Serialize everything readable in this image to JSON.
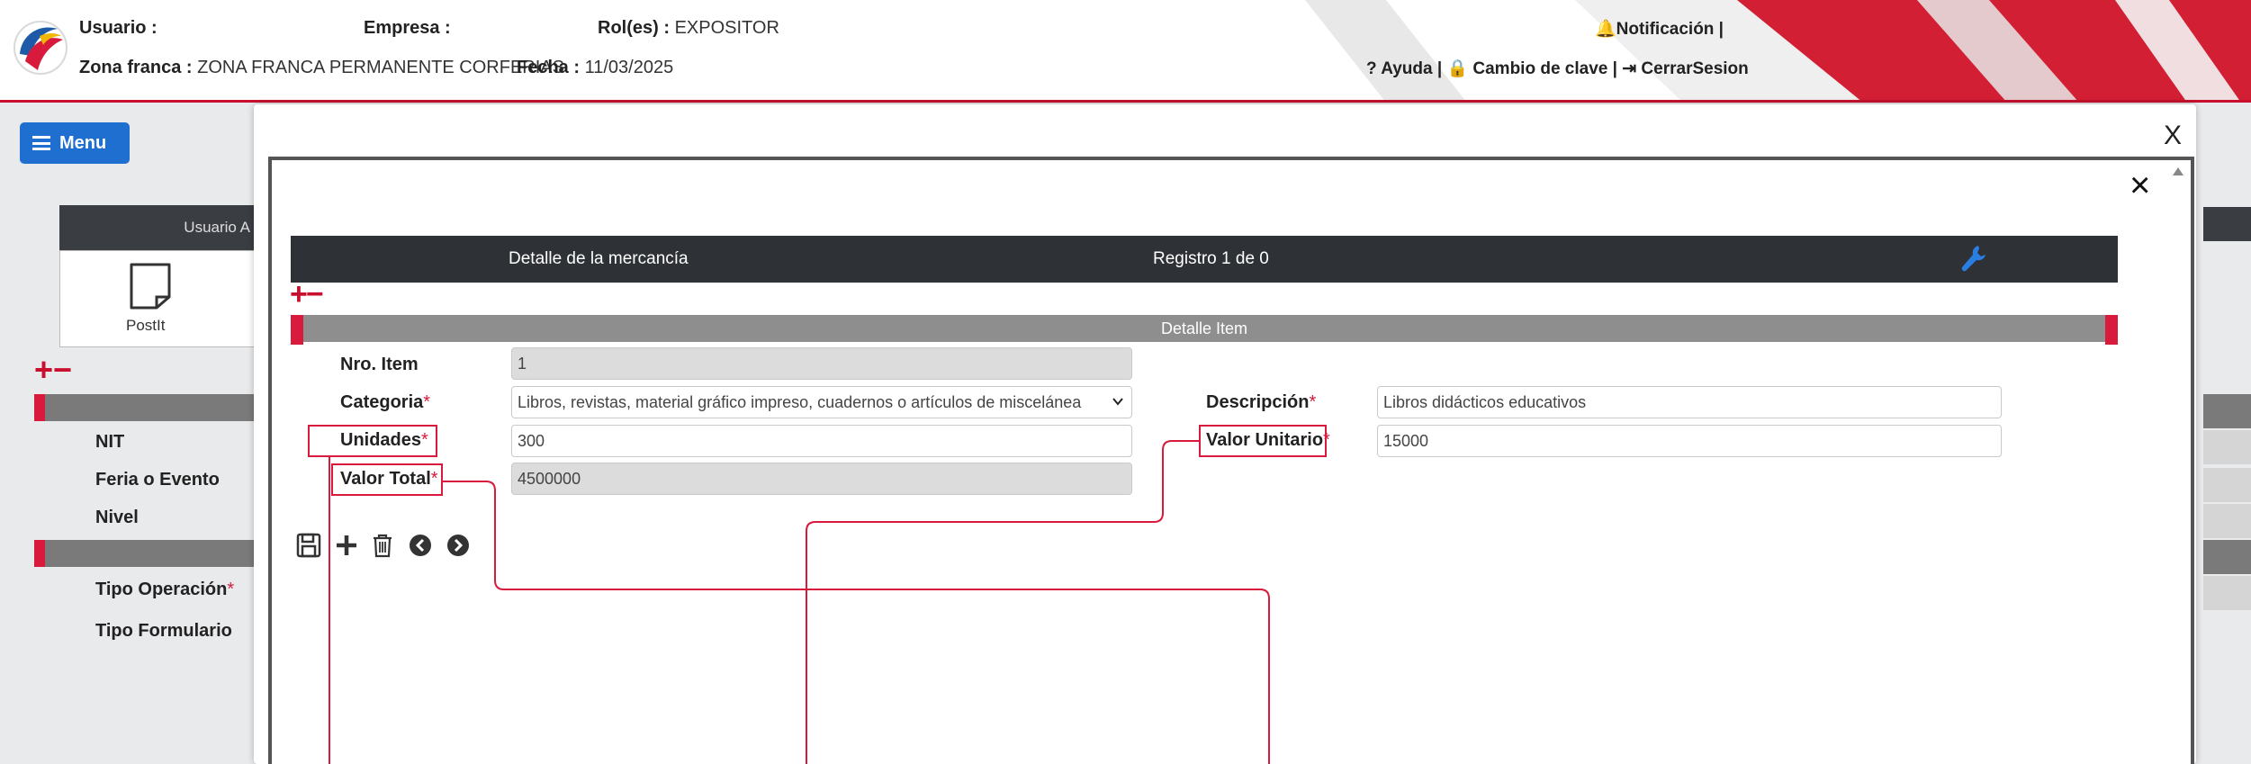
{
  "header": {
    "usuario_label": "Usuario :",
    "empresa_label": "Empresa :",
    "roles_label": "Rol(es) :",
    "roles_value": "EXPOSITOR",
    "zona_label": "Zona franca :",
    "zona_value": "ZONA FRANCA PERMANENTE CORFERIAS",
    "fecha_label": "Fecha :",
    "fecha_value": "11/03/2025",
    "notificacion": "Notificación |",
    "ayuda": "Ayuda |",
    "cambio_clave": "Cambio de clave |",
    "cerrar_sesion": "CerrarSesion",
    "accent_color": "#c8102e"
  },
  "background": {
    "menu_label": "Menu",
    "tab_label": "Usuario A",
    "postit_label": "PostIt",
    "fields": [
      "NIT",
      "Feria o Evento",
      "Nivel",
      "Tipo Operación",
      "Tipo Formulario"
    ],
    "required_mark": "*"
  },
  "modal": {
    "outer_close": "X",
    "inner_close": "×",
    "header_left": "Detalle de la mercancía",
    "header_center": "Registro 1 de 0",
    "section_title": "Detalle Item",
    "labels": {
      "nro_item": "Nro. Item",
      "categoria": "Categoria",
      "unidades": "Unidades",
      "valor_total": "Valor Total",
      "descripcion": "Descripción",
      "valor_unitario": "Valor Unitario"
    },
    "values": {
      "nro_item": "1",
      "categoria": "Libros, revistas, material gráfico impreso, cuadernos o artículos de miscelánea",
      "unidades": "300",
      "valor_total": "4500000",
      "descripcion": "Libros didácticos educativos",
      "valor_unitario": "15000"
    },
    "toolbar_icons": [
      "save-icon",
      "plus-icon",
      "trash-icon",
      "arrow-left-circle-icon",
      "arrow-right-circle-icon"
    ]
  }
}
